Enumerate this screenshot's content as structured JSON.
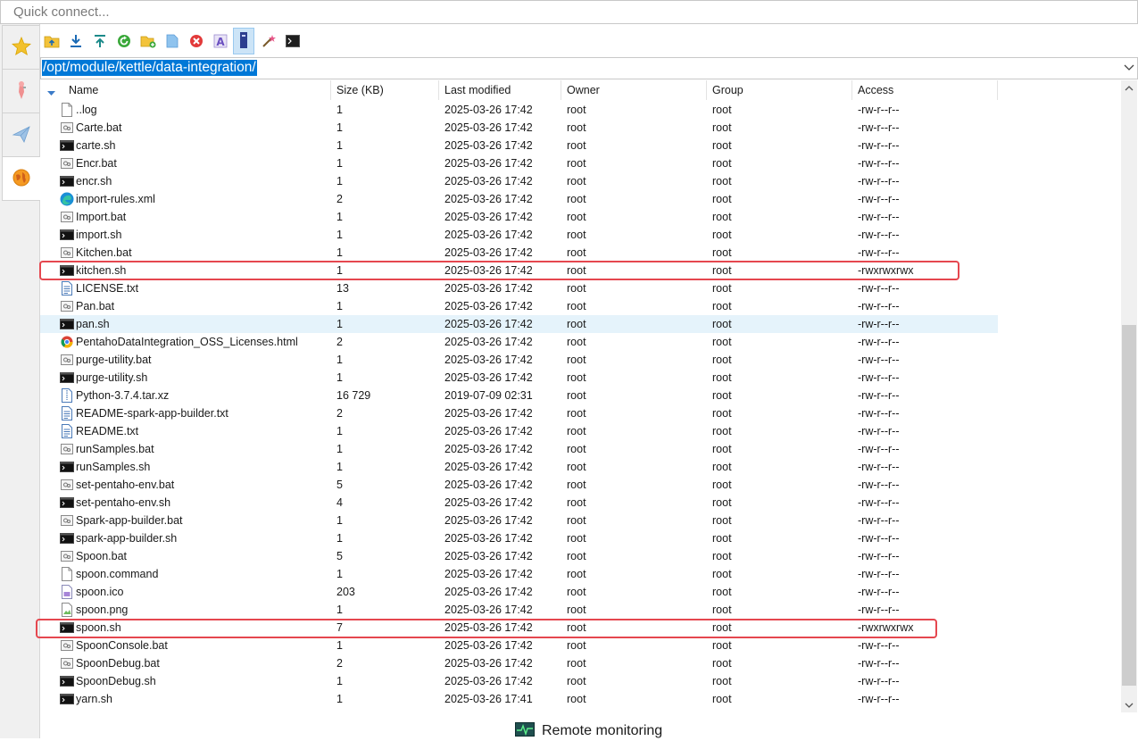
{
  "quick_connect": {
    "placeholder": "Quick connect..."
  },
  "sidebar": {
    "tabs": [
      {
        "icon": "star-icon",
        "active": false
      },
      {
        "icon": "torch-icon",
        "active": false
      },
      {
        "icon": "paper-plane-icon",
        "active": false
      },
      {
        "icon": "globe-icon",
        "active": true
      }
    ]
  },
  "toolbar": {
    "buttons": [
      {
        "icon": "parent-folder-icon"
      },
      {
        "icon": "download-icon"
      },
      {
        "icon": "upload-icon"
      },
      {
        "icon": "refresh-icon"
      },
      {
        "icon": "new-folder-icon"
      },
      {
        "icon": "new-file-icon"
      },
      {
        "icon": "delete-icon"
      },
      {
        "icon": "rename-icon"
      },
      {
        "icon": "properties-icon",
        "pressed": true
      },
      {
        "icon": "magic-wand-icon"
      },
      {
        "icon": "terminal-icon"
      }
    ]
  },
  "path": {
    "value": "/opt/module/kettle/data-integration/"
  },
  "columns": {
    "name": "Name",
    "size": "Size (KB)",
    "modified": "Last modified",
    "owner": "Owner",
    "group": "Group",
    "access": "Access"
  },
  "files": [
    {
      "name": "..log",
      "size": "1",
      "modified": "2025-03-26 17:42",
      "owner": "root",
      "group": "root",
      "access": "-rw-r--r--",
      "type": "blank"
    },
    {
      "name": "Carte.bat",
      "size": "1",
      "modified": "2025-03-26 17:42",
      "owner": "root",
      "group": "root",
      "access": "-rw-r--r--",
      "type": "bat"
    },
    {
      "name": "carte.sh",
      "size": "1",
      "modified": "2025-03-26 17:42",
      "owner": "root",
      "group": "root",
      "access": "-rw-r--r--",
      "type": "sh"
    },
    {
      "name": "Encr.bat",
      "size": "1",
      "modified": "2025-03-26 17:42",
      "owner": "root",
      "group": "root",
      "access": "-rw-r--r--",
      "type": "bat"
    },
    {
      "name": "encr.sh",
      "size": "1",
      "modified": "2025-03-26 17:42",
      "owner": "root",
      "group": "root",
      "access": "-rw-r--r--",
      "type": "sh"
    },
    {
      "name": "import-rules.xml",
      "size": "2",
      "modified": "2025-03-26 17:42",
      "owner": "root",
      "group": "root",
      "access": "-rw-r--r--",
      "type": "edge"
    },
    {
      "name": "Import.bat",
      "size": "1",
      "modified": "2025-03-26 17:42",
      "owner": "root",
      "group": "root",
      "access": "-rw-r--r--",
      "type": "bat"
    },
    {
      "name": "import.sh",
      "size": "1",
      "modified": "2025-03-26 17:42",
      "owner": "root",
      "group": "root",
      "access": "-rw-r--r--",
      "type": "sh"
    },
    {
      "name": "Kitchen.bat",
      "size": "1",
      "modified": "2025-03-26 17:42",
      "owner": "root",
      "group": "root",
      "access": "-rw-r--r--",
      "type": "bat"
    },
    {
      "name": "kitchen.sh",
      "size": "1",
      "modified": "2025-03-26 17:42",
      "owner": "root",
      "group": "root",
      "access": "-rwxrwxrwx",
      "type": "sh"
    },
    {
      "name": "LICENSE.txt",
      "size": "13",
      "modified": "2025-03-26 17:42",
      "owner": "root",
      "group": "root",
      "access": "-rw-r--r--",
      "type": "txt"
    },
    {
      "name": "Pan.bat",
      "size": "1",
      "modified": "2025-03-26 17:42",
      "owner": "root",
      "group": "root",
      "access": "-rw-r--r--",
      "type": "bat"
    },
    {
      "name": "pan.sh",
      "size": "1",
      "modified": "2025-03-26 17:42",
      "owner": "root",
      "group": "root",
      "access": "-rw-r--r--",
      "type": "sh"
    },
    {
      "name": "PentahoDataIntegration_OSS_Licenses.html",
      "size": "2",
      "modified": "2025-03-26 17:42",
      "owner": "root",
      "group": "root",
      "access": "-rw-r--r--",
      "type": "chrome"
    },
    {
      "name": "purge-utility.bat",
      "size": "1",
      "modified": "2025-03-26 17:42",
      "owner": "root",
      "group": "root",
      "access": "-rw-r--r--",
      "type": "bat"
    },
    {
      "name": "purge-utility.sh",
      "size": "1",
      "modified": "2025-03-26 17:42",
      "owner": "root",
      "group": "root",
      "access": "-rw-r--r--",
      "type": "sh"
    },
    {
      "name": "Python-3.7.4.tar.xz",
      "size": "16 729",
      "modified": "2019-07-09 02:31",
      "owner": "root",
      "group": "root",
      "access": "-rw-r--r--",
      "type": "archive"
    },
    {
      "name": "README-spark-app-builder.txt",
      "size": "2",
      "modified": "2025-03-26 17:42",
      "owner": "root",
      "group": "root",
      "access": "-rw-r--r--",
      "type": "txt"
    },
    {
      "name": "README.txt",
      "size": "1",
      "modified": "2025-03-26 17:42",
      "owner": "root",
      "group": "root",
      "access": "-rw-r--r--",
      "type": "txt"
    },
    {
      "name": "runSamples.bat",
      "size": "1",
      "modified": "2025-03-26 17:42",
      "owner": "root",
      "group": "root",
      "access": "-rw-r--r--",
      "type": "bat"
    },
    {
      "name": "runSamples.sh",
      "size": "1",
      "modified": "2025-03-26 17:42",
      "owner": "root",
      "group": "root",
      "access": "-rw-r--r--",
      "type": "sh"
    },
    {
      "name": "set-pentaho-env.bat",
      "size": "5",
      "modified": "2025-03-26 17:42",
      "owner": "root",
      "group": "root",
      "access": "-rw-r--r--",
      "type": "bat"
    },
    {
      "name": "set-pentaho-env.sh",
      "size": "4",
      "modified": "2025-03-26 17:42",
      "owner": "root",
      "group": "root",
      "access": "-rw-r--r--",
      "type": "sh"
    },
    {
      "name": "Spark-app-builder.bat",
      "size": "1",
      "modified": "2025-03-26 17:42",
      "owner": "root",
      "group": "root",
      "access": "-rw-r--r--",
      "type": "bat"
    },
    {
      "name": "spark-app-builder.sh",
      "size": "1",
      "modified": "2025-03-26 17:42",
      "owner": "root",
      "group": "root",
      "access": "-rw-r--r--",
      "type": "sh"
    },
    {
      "name": "Spoon.bat",
      "size": "5",
      "modified": "2025-03-26 17:42",
      "owner": "root",
      "group": "root",
      "access": "-rw-r--r--",
      "type": "bat"
    },
    {
      "name": "spoon.command",
      "size": "1",
      "modified": "2025-03-26 17:42",
      "owner": "root",
      "group": "root",
      "access": "-rw-r--r--",
      "type": "blank"
    },
    {
      "name": "spoon.ico",
      "size": "203",
      "modified": "2025-03-26 17:42",
      "owner": "root",
      "group": "root",
      "access": "-rw-r--r--",
      "type": "ico"
    },
    {
      "name": "spoon.png",
      "size": "1",
      "modified": "2025-03-26 17:42",
      "owner": "root",
      "group": "root",
      "access": "-rw-r--r--",
      "type": "png"
    },
    {
      "name": "spoon.sh",
      "size": "7",
      "modified": "2025-03-26 17:42",
      "owner": "root",
      "group": "root",
      "access": "-rwxrwxrwx",
      "type": "sh"
    },
    {
      "name": "SpoonConsole.bat",
      "size": "1",
      "modified": "2025-03-26 17:42",
      "owner": "root",
      "group": "root",
      "access": "-rw-r--r--",
      "type": "bat"
    },
    {
      "name": "SpoonDebug.bat",
      "size": "2",
      "modified": "2025-03-26 17:42",
      "owner": "root",
      "group": "root",
      "access": "-rw-r--r--",
      "type": "bat"
    },
    {
      "name": "SpoonDebug.sh",
      "size": "1",
      "modified": "2025-03-26 17:42",
      "owner": "root",
      "group": "root",
      "access": "-rw-r--r--",
      "type": "sh"
    },
    {
      "name": "yarn.sh",
      "size": "1",
      "modified": "2025-03-26 17:41",
      "owner": "root",
      "group": "root",
      "access": "-rw-r--r--",
      "type": "sh"
    }
  ],
  "hovered_row": "pan.sh",
  "highlighted_rows": [
    "kitchen.sh",
    "spoon.sh"
  ],
  "status": {
    "remote_monitoring": "Remote monitoring"
  },
  "colors": {
    "highlight_box": "#e5474f",
    "selection": "#0078d7",
    "hover_row": "#e5f3fb"
  }
}
